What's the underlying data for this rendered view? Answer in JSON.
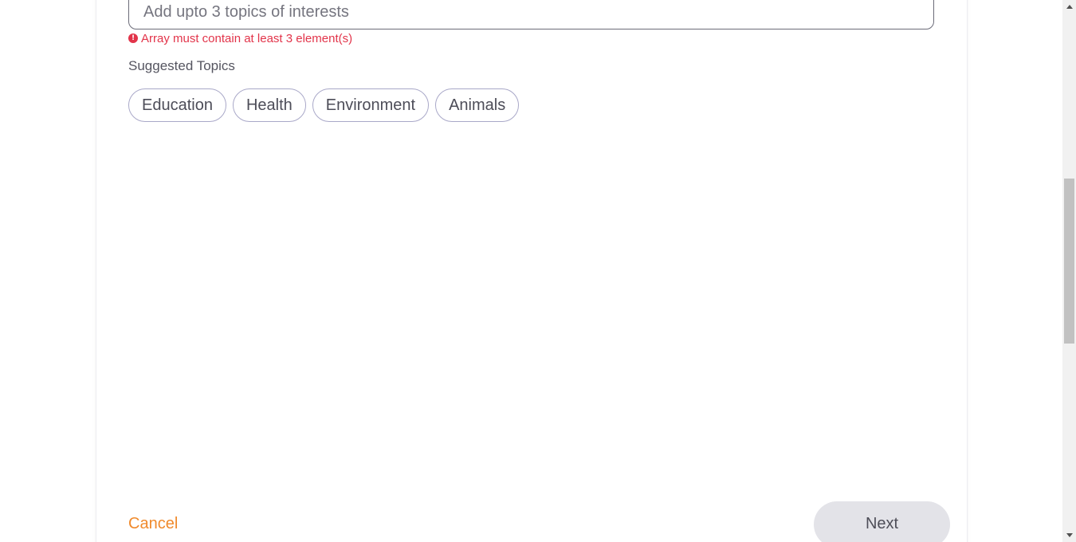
{
  "topics_input": {
    "placeholder": "Add upto 3 topics of interests",
    "value": ""
  },
  "validation": {
    "error_message": "Array must contain at least 3 element(s)",
    "icon": "error-icon",
    "color": "#e2344a"
  },
  "suggested": {
    "label": "Suggested Topics",
    "topics": [
      {
        "label": "Education"
      },
      {
        "label": "Health"
      },
      {
        "label": "Environment"
      },
      {
        "label": "Animals"
      }
    ]
  },
  "footer": {
    "cancel_label": "Cancel",
    "next_label": "Next",
    "cancel_color": "#f08a2c"
  },
  "scrollbar": {
    "up_icon": "scroll-up-arrow-icon",
    "down_icon": "scroll-down-arrow-icon"
  }
}
